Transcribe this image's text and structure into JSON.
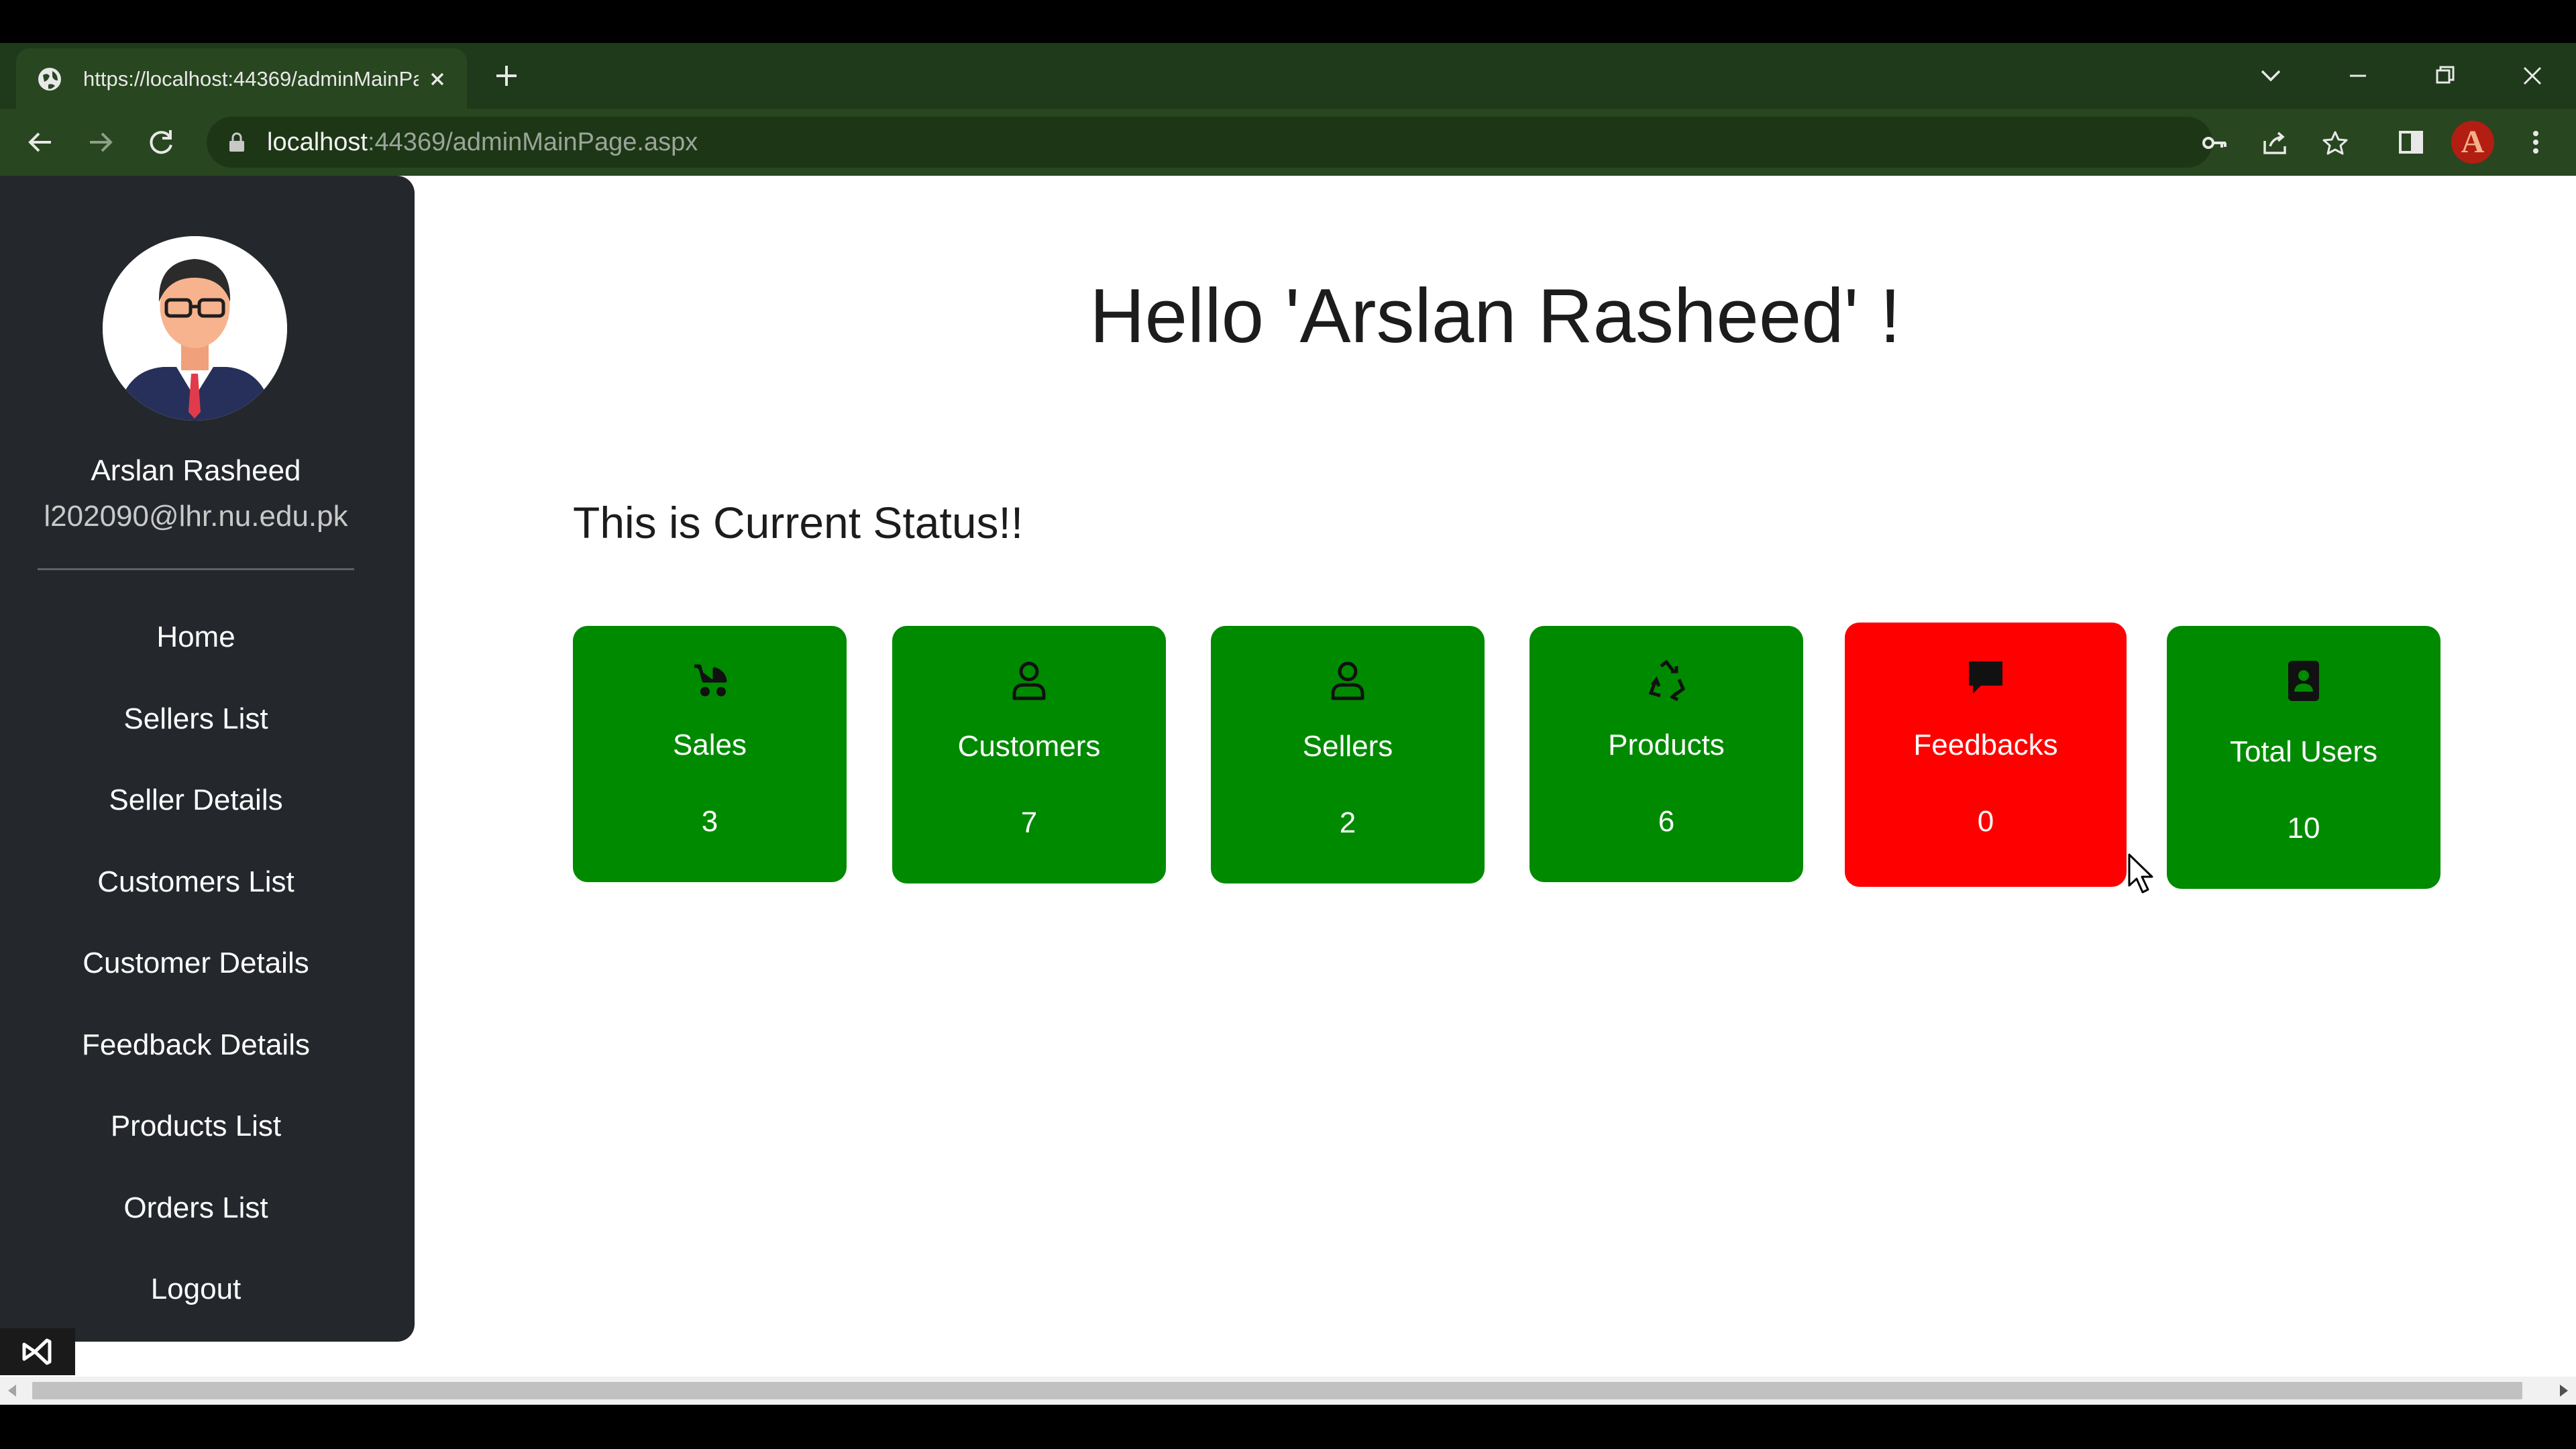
{
  "browser": {
    "tab_title": "https://localhost:44369/adminMainPage.aspx",
    "url_host": "localhost",
    "url_rest": ":44369/adminMainPage.aspx",
    "profile_initial": "A"
  },
  "sidebar": {
    "user_name": "Arslan Rasheed",
    "user_email": "l202090@lhr.nu.edu.pk",
    "items": [
      {
        "label": "Home"
      },
      {
        "label": "Sellers List"
      },
      {
        "label": "Seller Details"
      },
      {
        "label": "Customers List"
      },
      {
        "label": "Customer Details"
      },
      {
        "label": "Feedback Details"
      },
      {
        "label": "Products List"
      },
      {
        "label": "Orders List"
      },
      {
        "label": "Logout"
      }
    ]
  },
  "main": {
    "greeting": "Hello 'Arslan Rasheed' !",
    "status_heading": "This is Current Status!!",
    "cards": [
      {
        "label": "Sales",
        "value": "3",
        "icon": "baby-carriage-icon",
        "color": "#008a00"
      },
      {
        "label": "Customers",
        "value": "7",
        "icon": "person-icon",
        "color": "#008a00"
      },
      {
        "label": "Sellers",
        "value": "2",
        "icon": "person-icon",
        "color": "#008a00"
      },
      {
        "label": "Products",
        "value": "6",
        "icon": "recycle-icon",
        "color": "#008a00"
      },
      {
        "label": "Feedbacks",
        "value": "0",
        "icon": "chat-bubble-icon",
        "color": "#ff0000"
      },
      {
        "label": "Total Users",
        "value": "10",
        "icon": "contact-card-icon",
        "color": "#008a00"
      }
    ]
  }
}
